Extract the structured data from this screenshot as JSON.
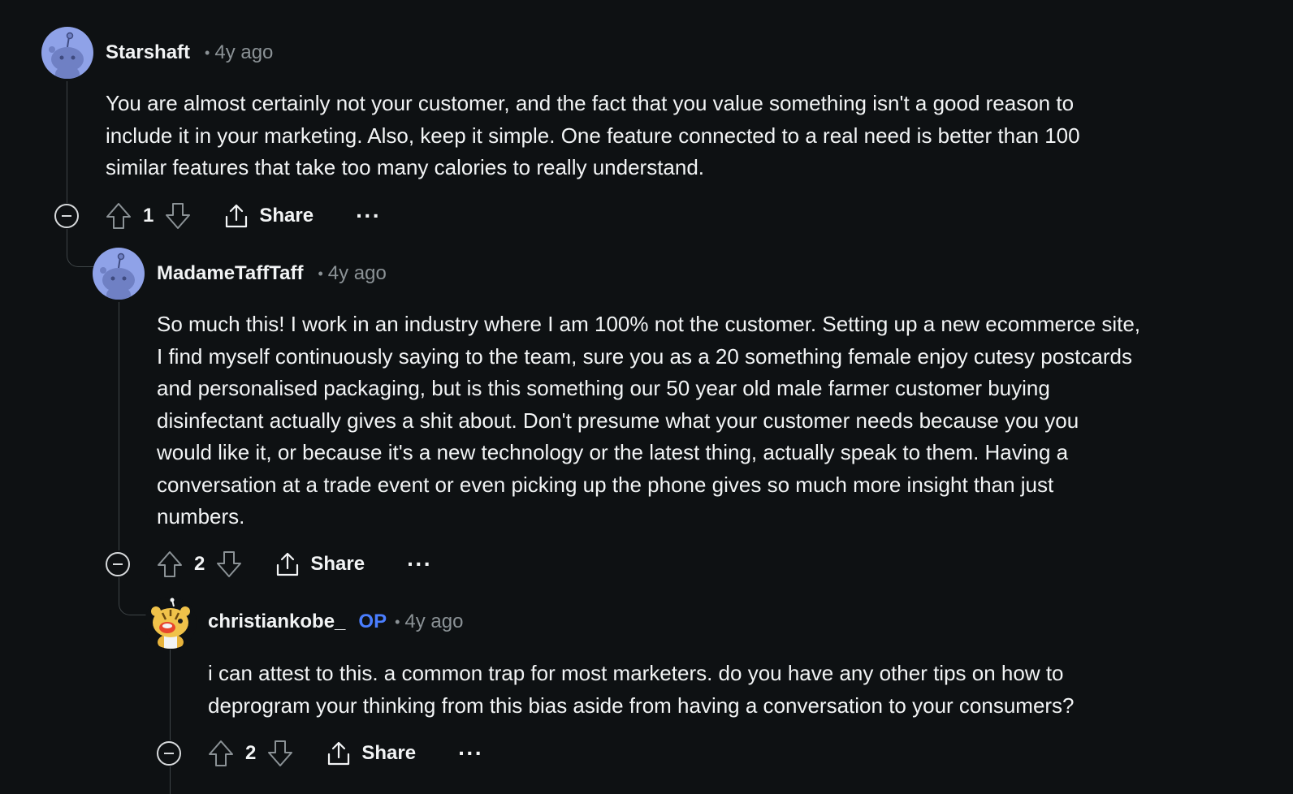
{
  "comments": [
    {
      "author": "Starshaft",
      "op_badge": "",
      "time": "4y ago",
      "lines": [
        "You are almost certainly not your customer, and the fact that you value something isn't a good reason to",
        "include it in your marketing. Also, keep it simple. One feature connected to a real need is better than 100",
        "similar features that take too many calories to really understand."
      ],
      "votes": "1",
      "share_label": "Share",
      "more_label": "···",
      "avatar_icon": "snoo-default-avatar"
    },
    {
      "author": "MadameTaffTaff",
      "op_badge": "",
      "time": "4y ago",
      "lines": [
        "So much this! I work in an industry where I am 100% not the customer. Setting up a new ecommerce site,",
        "I find myself continuously saying to the team, sure you as a 20 something female enjoy cutesy postcards",
        "and personalised packaging, but is this something our 50 year old male farmer customer buying",
        "disinfectant actually gives a shit about. Don't presume what your customer needs because you you",
        "would like it, or because it's a new technology or the latest thing, actually speak to them. Having a",
        "conversation at a trade event or even picking up the phone gives so much more insight than just",
        "numbers."
      ],
      "votes": "2",
      "share_label": "Share",
      "more_label": "···",
      "avatar_icon": "snoo-default-avatar"
    },
    {
      "author": "christiankobe_",
      "op_badge": "OP",
      "time": "4y ago",
      "lines": [
        "i can attest to this. a common trap for most marketers. do you have any other tips on how to",
        "deprogram your thinking from this bias aside from having a conversation to your consumers?"
      ],
      "votes": "2",
      "share_label": "Share",
      "more_label": "···",
      "avatar_icon": "snoo-tiger-avatar"
    }
  ],
  "dot_separator": "•",
  "colors": {
    "background": "#0e1113",
    "text": "#f2f4f5",
    "meta": "#8b9296",
    "op": "#4a7eff",
    "thread_line": "#3e4447",
    "avatar_default": "#8fa2e8"
  }
}
